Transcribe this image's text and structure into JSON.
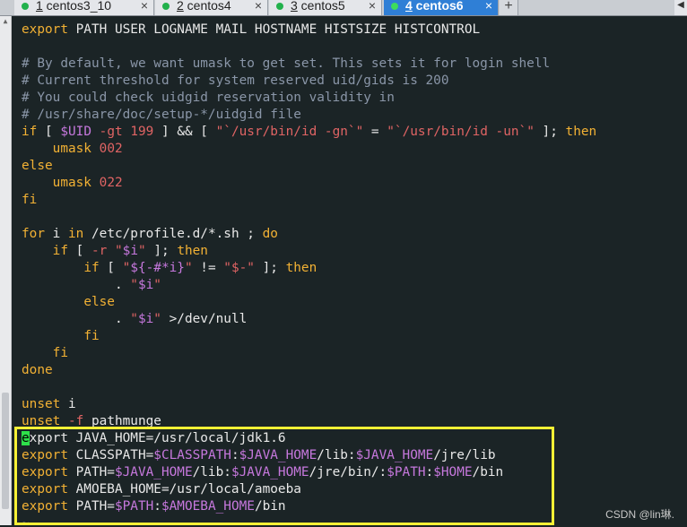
{
  "tabs": [
    {
      "num": "1",
      "label": " centos3_10",
      "active": false
    },
    {
      "num": "2",
      "label": " centos4",
      "active": false
    },
    {
      "num": "3",
      "label": " centos5",
      "active": false
    },
    {
      "num": "4",
      "label": " centos6",
      "active": true
    }
  ],
  "tab_close_glyph": "×",
  "add_tab_glyph": "+",
  "colors": {
    "background": "#1b2426",
    "keyword": "#f2b134",
    "comment": "#8a96a8",
    "number": "#e06464",
    "variable": "#c678dd",
    "highlight_box": "#f6f035",
    "cursor": "#2ee04a"
  },
  "terminal_lines": [
    [
      [
        "kw",
        "export"
      ],
      [
        "id",
        " PATH USER LOGNAME MAIL HOSTNAME HISTSIZE HISTCONTROL"
      ]
    ],
    [],
    [
      [
        "cm",
        "# By default, we want umask to get set. This sets it for login shell"
      ]
    ],
    [
      [
        "cm",
        "# Current threshold for system reserved uid/gids is 200"
      ]
    ],
    [
      [
        "cm",
        "# You could check uidgid reservation validity in"
      ]
    ],
    [
      [
        "cm",
        "# /usr/share/doc/setup-*/uidgid file"
      ]
    ],
    [
      [
        "kw",
        "if"
      ],
      [
        "op",
        " [ "
      ],
      [
        "var",
        "$UID"
      ],
      [
        "op",
        " "
      ],
      [
        "str",
        "-gt"
      ],
      [
        "op",
        " "
      ],
      [
        "num",
        "199"
      ],
      [
        "op",
        " ] && [ "
      ],
      [
        "str",
        "\"`/usr/bin/id -gn`\""
      ],
      [
        "op",
        " = "
      ],
      [
        "str",
        "\"`/usr/bin/id -un`\""
      ],
      [
        "op",
        " ]; "
      ],
      [
        "kw",
        "then"
      ]
    ],
    [
      [
        "id",
        "    "
      ],
      [
        "kw",
        "umask"
      ],
      [
        "op",
        " "
      ],
      [
        "num",
        "002"
      ]
    ],
    [
      [
        "kw",
        "else"
      ]
    ],
    [
      [
        "id",
        "    "
      ],
      [
        "kw",
        "umask"
      ],
      [
        "op",
        " "
      ],
      [
        "num",
        "022"
      ]
    ],
    [
      [
        "kw",
        "fi"
      ]
    ],
    [],
    [
      [
        "kw",
        "for"
      ],
      [
        "id",
        " i "
      ],
      [
        "kw",
        "in"
      ],
      [
        "id",
        " /etc/profile.d/*.sh ; "
      ],
      [
        "kw",
        "do"
      ]
    ],
    [
      [
        "id",
        "    "
      ],
      [
        "kw",
        "if"
      ],
      [
        "op",
        " [ "
      ],
      [
        "str",
        "-r"
      ],
      [
        "op",
        " "
      ],
      [
        "str",
        "\""
      ],
      [
        "var",
        "$i"
      ],
      [
        "str",
        "\""
      ],
      [
        "op",
        " ]; "
      ],
      [
        "kw",
        "then"
      ]
    ],
    [
      [
        "id",
        "        "
      ],
      [
        "kw",
        "if"
      ],
      [
        "op",
        " [ "
      ],
      [
        "str",
        "\""
      ],
      [
        "var",
        "${-#*i}"
      ],
      [
        "str",
        "\""
      ],
      [
        "op",
        " != "
      ],
      [
        "str",
        "\"$-\""
      ],
      [
        "op",
        " ]; "
      ],
      [
        "kw",
        "then"
      ]
    ],
    [
      [
        "id",
        "            . "
      ],
      [
        "str",
        "\""
      ],
      [
        "var",
        "$i"
      ],
      [
        "str",
        "\""
      ]
    ],
    [
      [
        "id",
        "        "
      ],
      [
        "kw",
        "else"
      ]
    ],
    [
      [
        "id",
        "            . "
      ],
      [
        "str",
        "\""
      ],
      [
        "var",
        "$i"
      ],
      [
        "str",
        "\""
      ],
      [
        "op",
        " >/dev/null"
      ]
    ],
    [
      [
        "id",
        "        "
      ],
      [
        "kw",
        "fi"
      ]
    ],
    [
      [
        "id",
        "    "
      ],
      [
        "kw",
        "fi"
      ]
    ],
    [
      [
        "kw",
        "done"
      ]
    ],
    [],
    [
      [
        "kw",
        "unset"
      ],
      [
        "id",
        " i"
      ]
    ],
    [
      [
        "kw",
        "unset"
      ],
      [
        "op",
        " "
      ],
      [
        "str",
        "-f"
      ],
      [
        "id",
        " pathmunge"
      ]
    ],
    [
      [
        "cur",
        "e"
      ],
      [
        "id",
        "xport JAVA_HOME=/usr/local/jdk1.6"
      ]
    ],
    [
      [
        "kw",
        "export"
      ],
      [
        "id",
        " CLASSPATH="
      ],
      [
        "var",
        "$CLASSPATH"
      ],
      [
        "id",
        ":"
      ],
      [
        "var",
        "$JAVA_HOME"
      ],
      [
        "id",
        "/lib:"
      ],
      [
        "var",
        "$JAVA_HOME"
      ],
      [
        "id",
        "/jre/lib"
      ]
    ],
    [
      [
        "kw",
        "export"
      ],
      [
        "id",
        " PATH="
      ],
      [
        "var",
        "$JAVA_HOME"
      ],
      [
        "id",
        "/lib:"
      ],
      [
        "var",
        "$JAVA_HOME"
      ],
      [
        "id",
        "/jre/bin/:"
      ],
      [
        "var",
        "$PATH"
      ],
      [
        "id",
        ":"
      ],
      [
        "var",
        "$HOME"
      ],
      [
        "id",
        "/bin"
      ]
    ],
    [
      [
        "kw",
        "export"
      ],
      [
        "id",
        " AMOEBA_HOME=/usr/local/amoeba"
      ]
    ],
    [
      [
        "kw",
        "export"
      ],
      [
        "id",
        " PATH="
      ],
      [
        "var",
        "$PATH"
      ],
      [
        "id",
        ":"
      ],
      [
        "var",
        "$AMOEBA_HOME"
      ],
      [
        "id",
        "/bin"
      ]
    ],
    [
      [
        "cm",
        "~"
      ]
    ]
  ],
  "watermark": "CSDN @lin琳."
}
